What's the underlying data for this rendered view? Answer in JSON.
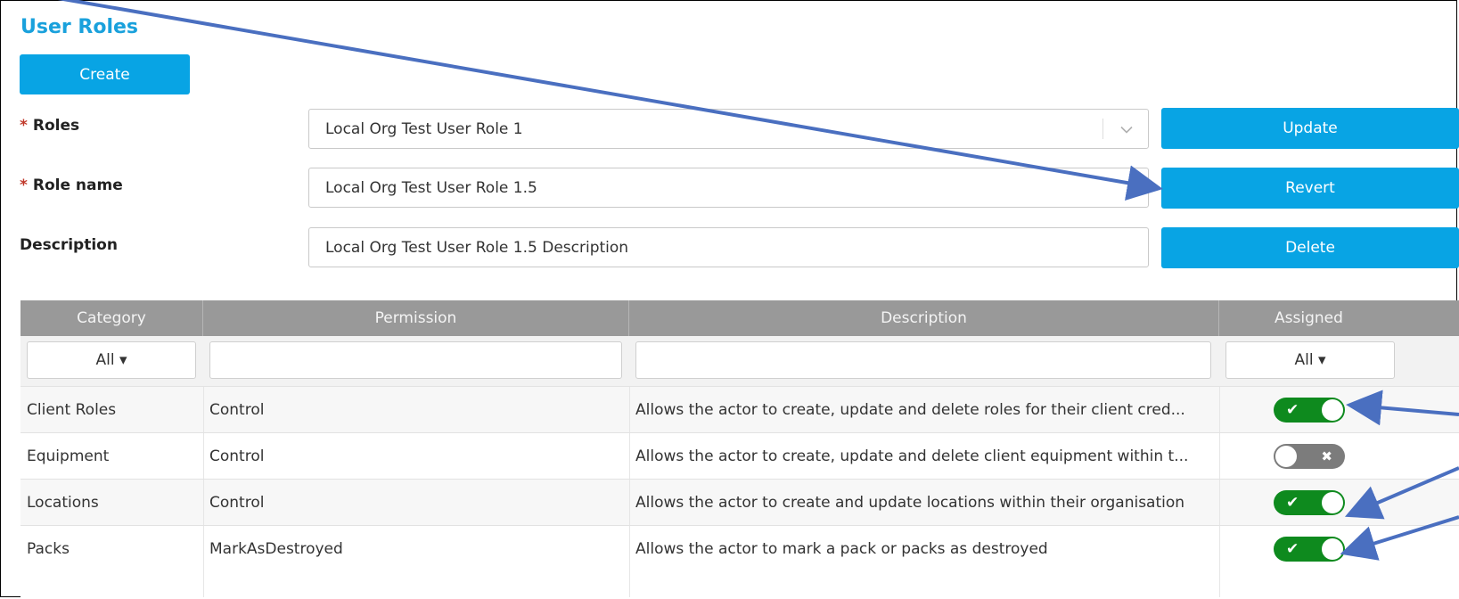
{
  "page": {
    "title": "User Roles"
  },
  "toolbar": {
    "create_label": "Create"
  },
  "form": {
    "roles": {
      "required_mark": "*",
      "label": "Roles",
      "value": "Local Org Test User Role 1",
      "chevron": "chevron-down-icon"
    },
    "role_name": {
      "required_mark": "*",
      "label": "Role name",
      "value": "Local Org Test User Role 1.5"
    },
    "description": {
      "label": "Description",
      "value": "Local Org Test User Role 1.5 Description"
    },
    "update_label": "Update",
    "revert_label": "Revert",
    "delete_label": "Delete"
  },
  "table": {
    "headers": {
      "category": "Category",
      "permission": "Permission",
      "description": "Description",
      "assigned": "Assigned"
    },
    "filters": {
      "category": "All ▾",
      "permission": "",
      "description": "",
      "assigned": "All ▾"
    },
    "rows": [
      {
        "category": "Client Roles",
        "permission": "Control",
        "description": "Allows the actor to create, update and delete roles for their client cred...",
        "assigned": true,
        "glyph": "✔"
      },
      {
        "category": "Equipment",
        "permission": "Control",
        "description": "Allows the actor to create, update and delete client equipment within t...",
        "assigned": false,
        "glyph": "✖"
      },
      {
        "category": "Locations",
        "permission": "Control",
        "description": "Allows the actor to create and update locations within their organisation",
        "assigned": true,
        "glyph": "✔"
      },
      {
        "category": "Packs",
        "permission": "MarkAsDestroyed",
        "description": "Allows the actor to mark a pack or packs as destroyed",
        "assigned": true,
        "glyph": "✔"
      }
    ]
  },
  "colors": {
    "accent": "#08a4e4",
    "title": "#1aa1dc",
    "header_bg": "#999999",
    "toggle_on": "#0e8a1e",
    "toggle_off": "#7c7c7c",
    "annotation_arrow": "#4a6fc0"
  }
}
